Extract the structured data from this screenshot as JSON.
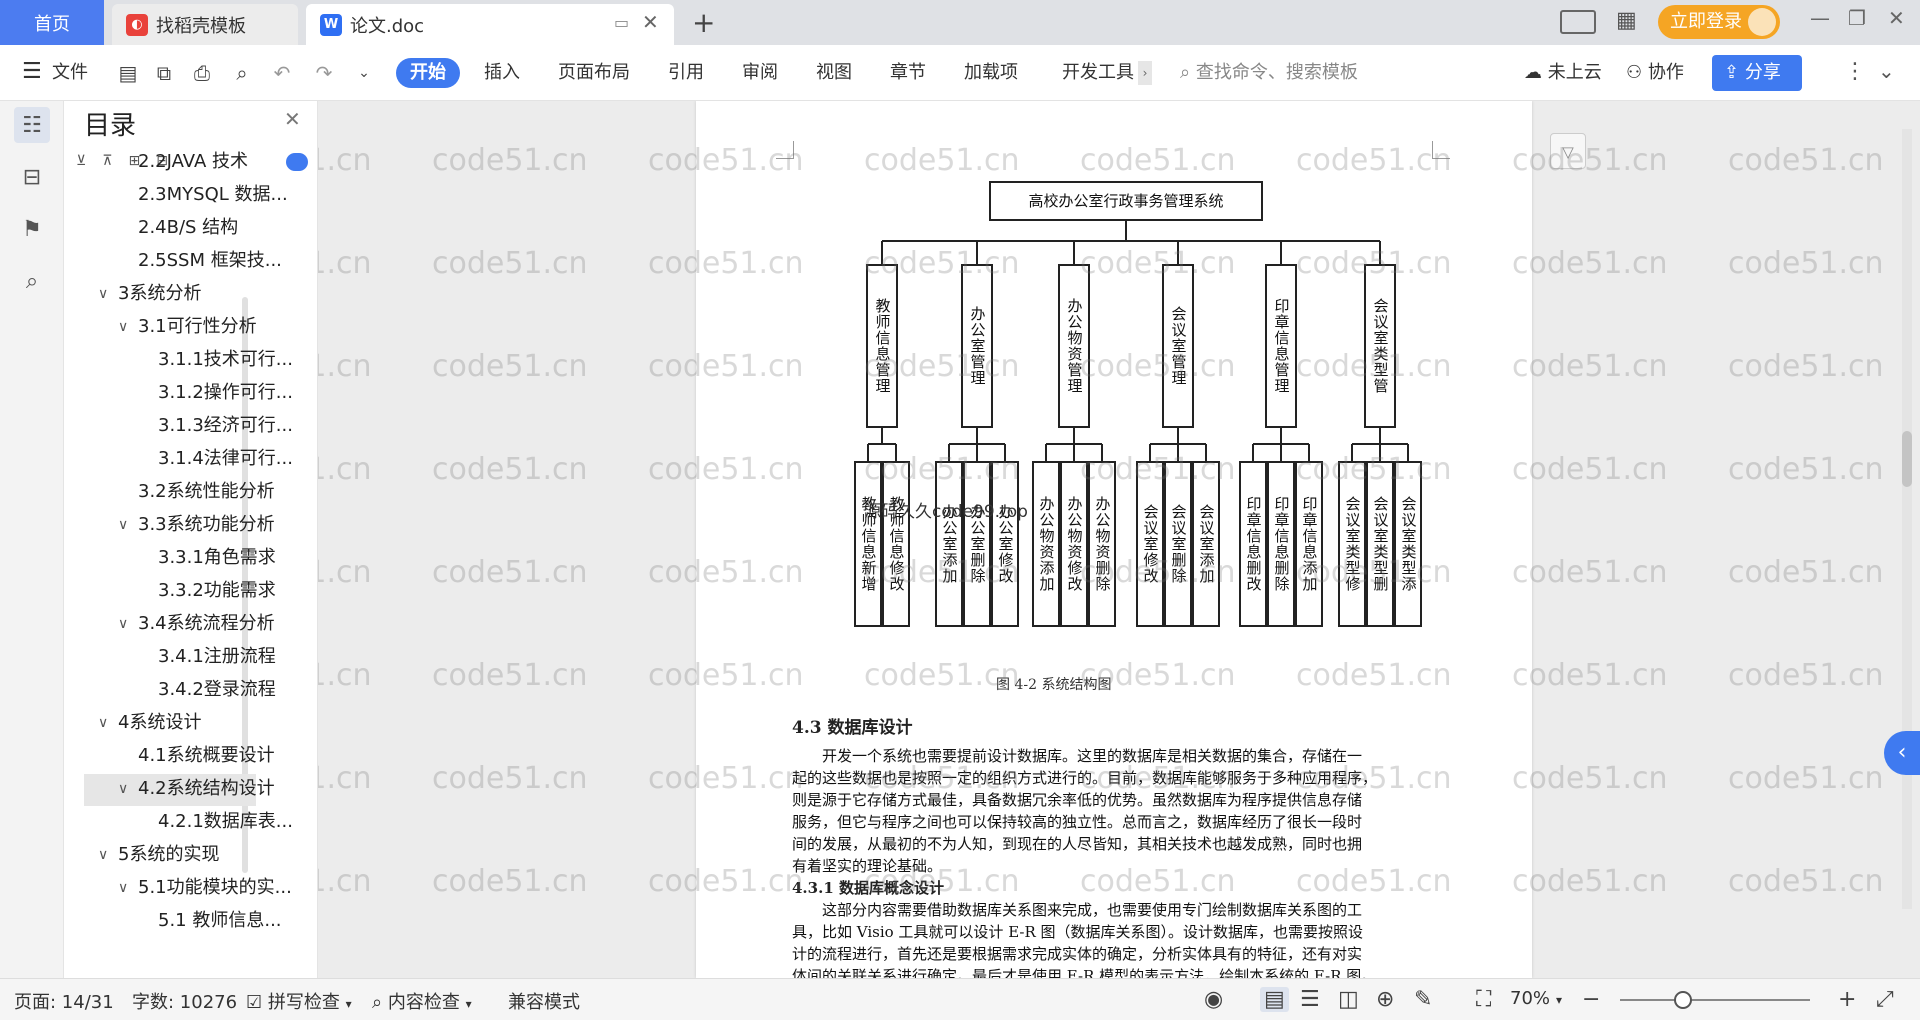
{
  "tabs": {
    "home": "首页",
    "template": "找稻壳模板",
    "document": "论文.doc",
    "new_tab": "+",
    "login": "立即登录"
  },
  "menu": {
    "file": "文件",
    "items": [
      "开始",
      "插入",
      "页面布局",
      "引用",
      "审阅",
      "视图",
      "章节",
      "加载项",
      "开发工具"
    ],
    "search_placeholder": "查找命令、搜索模板",
    "cloud": "未上云",
    "collab": "协作",
    "share": "分享"
  },
  "toc": {
    "title": "目录",
    "items": [
      {
        "text": "2.2JAVA 技术",
        "level": 2
      },
      {
        "text": "2.3MYSQL 数据...",
        "level": 2
      },
      {
        "text": "2.4B/S 结构",
        "level": 2
      },
      {
        "text": "2.5SSM 框架技...",
        "level": 2
      },
      {
        "text": "3系统分析",
        "level": 1
      },
      {
        "text": "3.1可行性分析",
        "level": 2
      },
      {
        "text": "3.1.1技术可行...",
        "level": 3
      },
      {
        "text": "3.1.2操作可行...",
        "level": 3
      },
      {
        "text": "3.1.3经济可行...",
        "level": 3
      },
      {
        "text": "3.1.4法律可行...",
        "level": 3
      },
      {
        "text": "3.2系统性能分析",
        "level": 2
      },
      {
        "text": "3.3系统功能分析",
        "level": 2
      },
      {
        "text": "3.3.1角色需求",
        "level": 3
      },
      {
        "text": "3.3.2功能需求",
        "level": 3
      },
      {
        "text": "3.4系统流程分析",
        "level": 2
      },
      {
        "text": "3.4.1注册流程",
        "level": 3
      },
      {
        "text": "3.4.2登录流程",
        "level": 3
      },
      {
        "text": "4系统设计",
        "level": 1
      },
      {
        "text": "4.1系统概要设计",
        "level": 2
      },
      {
        "text": "4.2系统结构设计",
        "level": 2
      },
      {
        "text": "4.2.1数据库表...",
        "level": 3
      },
      {
        "text": "5系统的实现",
        "level": 1
      },
      {
        "text": "5.1功能模块的实...",
        "level": 2
      },
      {
        "text": "5.1 教师信息...",
        "level": 3
      }
    ]
  },
  "diagram": {
    "root": "高校办公室行政事务管理系统",
    "modules": [
      {
        "name": "教师信息管理",
        "children": [
          "教师信息新增",
          "教师信息修改"
        ]
      },
      {
        "name": "办公室管理",
        "children": [
          "办公室添加",
          "办公室删除",
          "办公室修改"
        ]
      },
      {
        "name": "办公物资管理",
        "children": [
          "办公物资添加",
          "办公物资修改",
          "办公物资删除"
        ]
      },
      {
        "name": "会议室管理",
        "children": [
          "会议室修改",
          "会议室删除",
          "会议室添加"
        ]
      },
      {
        "name": "印章信息管理",
        "children": [
          "印章信息删改",
          "印章信息删除",
          "印章信息添加"
        ]
      },
      {
        "name": "会议室类型管",
        "children": [
          "会议室类型修",
          "会议室类型删",
          "会议室类型添"
        ]
      }
    ],
    "caption": "图 4-2  系统结构图",
    "overlay": "源码久久code99.top"
  },
  "body": {
    "h1": "4.3  数据库设计",
    "p1": [
      "开发一个系统也需要提前设计数据库。这里的数据库是相关数据的集合，存储在一",
      "起的这些数据也是按照一定的组织方式进行的。目前，数据库能够服务于多种应用程序，",
      "则是源于它存储方式最佳，具备数据冗余率低的优势。虽然数据库为程序提供信息存储",
      "服务，但它与程序之间也可以保持较高的独立性。总而言之，数据库经历了很长一段时",
      "间的发展，从最初的不为人知，到现在的人尽皆知，其相关技术也越发成熟，同时也拥",
      "有着坚实的理论基础。"
    ],
    "h2": "4.3.1  数据库概念设计",
    "p2": [
      "这部分内容需要借助数据库关系图来完成，也需要使用专门绘制数据库关系图的工",
      "具，比如 Visio 工具就可以设计 E-R 图（数据库关系图）。设计数据库，也需要按照设",
      "计的流程进行，首先还是要根据需求完成实体的确定，分析实体具有的特征，还有对实",
      "体间的关联关系进行确定。最后才是使用 E-R 模型的表示方法，绘制本系统的 E-R 图。"
    ]
  },
  "watermark": "code51.cn",
  "status": {
    "page": "页面: 14/31",
    "words": "字数: 10276",
    "spell": "拼写检查",
    "content": "内容检查",
    "compat": "兼容模式",
    "zoom": "70%"
  }
}
